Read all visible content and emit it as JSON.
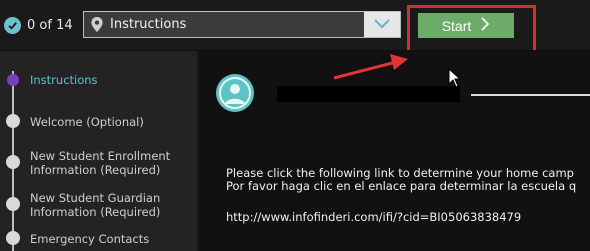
{
  "topbar": {
    "progress_text": "0 of 14",
    "section_dropdown": {
      "selected": "Instructions"
    },
    "start_label": "Start"
  },
  "sidebar": {
    "items": [
      {
        "label_lines": [
          "Instructions"
        ],
        "active": true
      },
      {
        "label_lines": [
          "Welcome (Optional)"
        ],
        "active": false
      },
      {
        "label_lines": [
          "New Student Enrollment",
          "Information (Required)"
        ],
        "active": false
      },
      {
        "label_lines": [
          "New Student Guardian",
          "Information (Required)"
        ],
        "active": false
      },
      {
        "label_lines": [
          "Emergency Contacts"
        ],
        "active": false
      }
    ]
  },
  "main": {
    "instructions_en": "Please click the following link to determine your home camp",
    "instructions_es": "Por favor haga clic en el enlace para determinar la escuela q",
    "link_url": "http://www.infofinderi.com/ifi/?cid=BI05063838479"
  },
  "colors": {
    "accent_teal": "#57c8cf",
    "start_green": "#6dab6a",
    "highlight_red": "#d62d2d",
    "active_node_purple": "#7a3fbf"
  },
  "icons": [
    "check-circle-icon",
    "map-pin-icon",
    "chevron-down-icon",
    "chevron-right-icon",
    "user-avatar-icon",
    "mouse-cursor-icon",
    "red-arrow-annotation"
  ]
}
